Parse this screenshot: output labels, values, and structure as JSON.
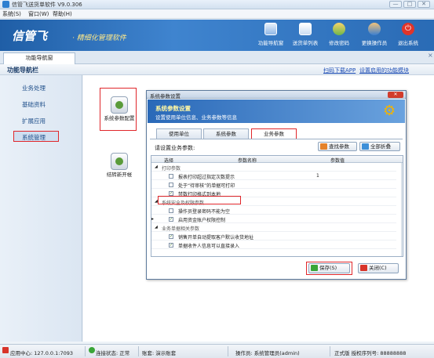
{
  "window": {
    "title": "信管飞送货单软件 V9.0.306",
    "controls": [
      "—",
      "□",
      "✕"
    ]
  },
  "menu": [
    "系统(S)",
    "窗口(W)",
    "帮助(H)"
  ],
  "banner": {
    "logo": "信管飞",
    "tagline": "· 精细化管理软件",
    "toolbar": [
      "功能导航窗",
      "送货单列表",
      "修改密码",
      "更换操作员",
      "退出系统"
    ]
  },
  "nav": {
    "tab": "功能导航窗",
    "close": "×"
  },
  "section": {
    "title": "功能导航栏",
    "links": [
      "扫码下载APP",
      "设置启用的功能模块"
    ]
  },
  "sidebar": {
    "items": [
      "业务处理",
      "基础资料",
      "扩展应用",
      "系统管理"
    ],
    "active": "系统管理"
  },
  "modules": [
    "系统参数配置",
    "结转新开帐"
  ],
  "dialog": {
    "title": "系统参数设置",
    "header_title": "系统参数设置",
    "header_sub": "设置使用单位信息、业务参数等信息",
    "tabs": [
      "使用单位",
      "系统参数",
      "业务参数"
    ],
    "active_tab": "业务参数",
    "prompt": "请设置业务参数:",
    "find_button": "查找参数",
    "collapse_button": "全部折叠",
    "columns": [
      "选择",
      "参数名称",
      "参数值"
    ],
    "rows": [
      {
        "group": "打印参数"
      },
      {
        "checked": false,
        "name": "报表打印超过指定次数提示",
        "value": "1"
      },
      {
        "checked": false,
        "name": "处于“待审核”的单据可打印",
        "value": ""
      },
      {
        "checked": true,
        "name": "禁数打印格式到本地",
        "value": ""
      },
      {
        "group": "系统安全及权限参数"
      },
      {
        "checked": false,
        "name": "操作员登录密码不能为空",
        "value": ""
      },
      {
        "checked": true,
        "name": "启用资金账户权限控制",
        "value": ""
      },
      {
        "group": "业务单据相关参数"
      },
      {
        "checked": true,
        "name": "销售开单自动提取客户默认收货地址",
        "value": ""
      },
      {
        "checked": true,
        "name": "单据收件人信息可以直接录入",
        "value": ""
      }
    ],
    "save_button": "保存(S)",
    "close_button": "关闭(C)"
  },
  "status": {
    "center": "应用中心: 127.0.0.1:7093",
    "conn": "连接状态: 正常",
    "account": "账套: 演示账套",
    "operator": "操作员: 系统管理员(admin)",
    "license": "正式版 授权序列号: 88888888"
  },
  "colors": {
    "accent": "#2a69b8",
    "highlight": "#e0262a",
    "banner": "#1f5ea6"
  }
}
